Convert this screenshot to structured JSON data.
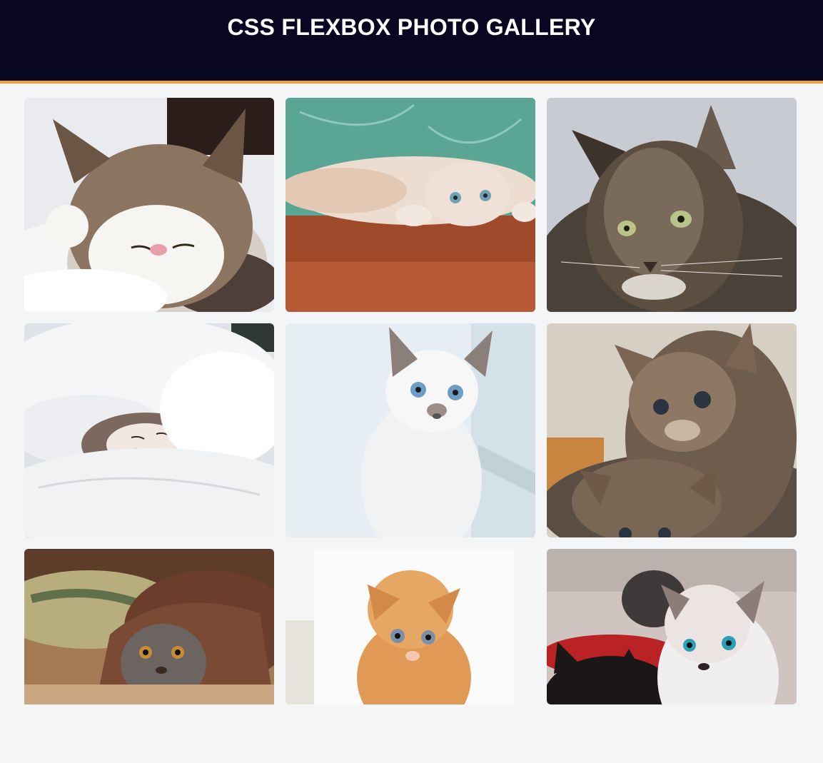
{
  "header": {
    "title": "CSS FLEXBOX PHOTO GALLERY"
  },
  "colors": {
    "header_bg": "#080620",
    "accent": "#f0a040",
    "page_bg": "#f4f5f7"
  },
  "gallery": {
    "photos": [
      {
        "subject": "tabby and white cat sleeping on white bedding"
      },
      {
        "subject": "kitten lying upside down on wooden floor"
      },
      {
        "subject": "grey tabby cat portrait"
      },
      {
        "subject": "cat sleeping under white duvet"
      },
      {
        "subject": "white fluffy kitten with blue eyes"
      },
      {
        "subject": "two tabby kittens"
      },
      {
        "subject": "tabby kitten under shaggy blanket"
      },
      {
        "subject": "orange kitten on white background"
      },
      {
        "subject": "white kitten with blue eyes and black kitten"
      }
    ]
  }
}
